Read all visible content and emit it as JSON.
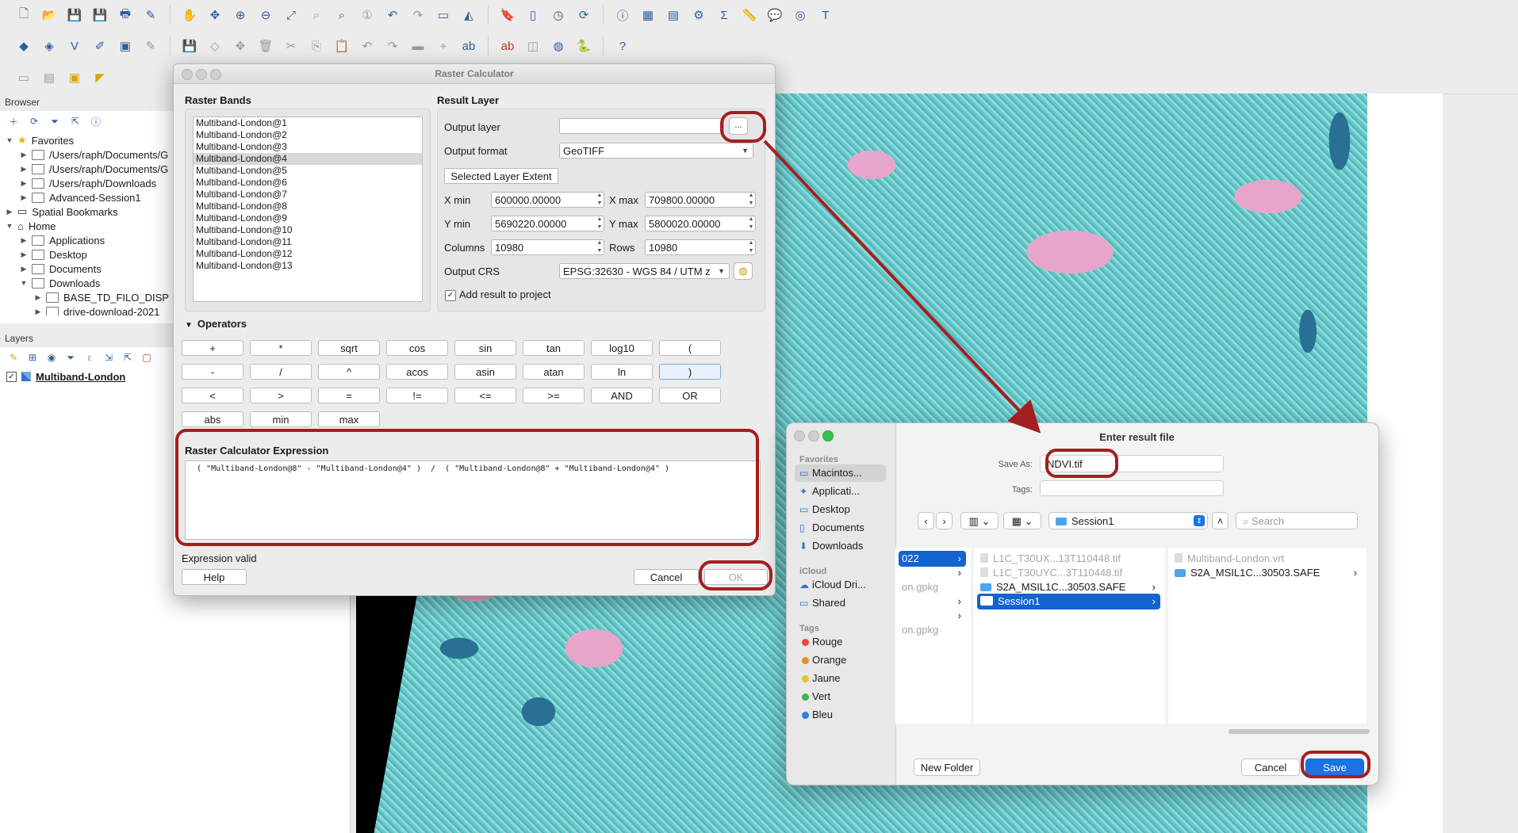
{
  "toolbars": {
    "row1_icons": [
      "new-project-icon",
      "open-project-icon",
      "save-project-icon",
      "save-as-icon",
      "print-layout-icon",
      "style-manager-icon",
      "pan-icon",
      "pan-to-selection-icon",
      "zoom-in-icon",
      "zoom-out-icon",
      "zoom-full-icon",
      "zoom-to-selection-icon",
      "zoom-to-layer-icon",
      "zoom-native-icon",
      "zoom-last-icon",
      "zoom-next-icon",
      "new-map-view-icon",
      "new-3d-view-icon",
      "new-bookmark-icon",
      "show-bookmarks-icon",
      "temporal-icon",
      "refresh-icon",
      "identify-icon",
      "attribute-table-icon",
      "field-calculator-icon",
      "processing-icon",
      "statistics-icon",
      "measure-icon",
      "map-tips-icon",
      "annotation-icon",
      "text-annotation-icon"
    ],
    "row2_icons": [
      "data-source-manager-icon",
      "new-geopackage-icon",
      "new-shapefile-icon",
      "digitize-icon",
      "vertex-tool-icon",
      "edit-pencil-icon",
      "save-edits-icon",
      "add-feature-icon",
      "move-feature-icon",
      "delete-icon",
      "cut-icon",
      "copy-icon",
      "paste-icon",
      "undo-icon",
      "redo-icon",
      "label-icon",
      "label-pin-icon",
      "abc-icon",
      "abc-red-icon",
      "label-tools-icon",
      "plugin-globe-icon",
      "python-icon",
      "help-icon"
    ]
  },
  "browser": {
    "title": "Browser",
    "items": [
      {
        "label": "Favorites",
        "level": 0,
        "open": true
      },
      {
        "label": "/Users/raph/Documents/G",
        "level": 1
      },
      {
        "label": "/Users/raph/Documents/G",
        "level": 1
      },
      {
        "label": "/Users/raph/Downloads",
        "level": 1
      },
      {
        "label": "Advanced-Session1",
        "level": 1
      },
      {
        "label": "Spatial Bookmarks",
        "level": 0
      },
      {
        "label": "Home",
        "level": 0,
        "open": true
      },
      {
        "label": "Applications",
        "level": 1
      },
      {
        "label": "Desktop",
        "level": 1
      },
      {
        "label": "Documents",
        "level": 1
      },
      {
        "label": "Downloads",
        "level": 1,
        "open": true
      },
      {
        "label": "BASE_TD_FILO_DISP",
        "level": 2
      },
      {
        "label": "drive-download-2021",
        "level": 2
      }
    ]
  },
  "layers": {
    "title": "Layers",
    "items": [
      {
        "label": "Multiband-London",
        "checked": true
      }
    ]
  },
  "calc": {
    "title": "Raster Calculator",
    "raster_bands_label": "Raster Bands",
    "bands": [
      "Multiband-London@1",
      "Multiband-London@2",
      "Multiband-London@3",
      "Multiband-London@4",
      "Multiband-London@5",
      "Multiband-London@6",
      "Multiband-London@7",
      "Multiband-London@8",
      "Multiband-London@9",
      "Multiband-London@10",
      "Multiband-London@11",
      "Multiband-London@12",
      "Multiband-London@13"
    ],
    "selected_band_index": 3,
    "result_layer_label": "Result Layer",
    "output_layer_label": "Output layer",
    "output_layer_value": "",
    "browse_label": "...",
    "output_format_label": "Output format",
    "output_format_value": "GeoTIFF",
    "extent_button": "Selected Layer Extent",
    "xmin_label": "X min",
    "xmin_value": "600000.00000",
    "xmax_label": "X max",
    "xmax_value": "709800.00000",
    "ymin_label": "Y min",
    "ymin_value": "5690220.00000",
    "ymax_label": "Y max",
    "ymax_value": "5800020.00000",
    "columns_label": "Columns",
    "columns_value": "10980",
    "rows_label": "Rows",
    "rows_value": "10980",
    "crs_label": "Output CRS",
    "crs_value": "EPSG:32630 - WGS 84 / UTM z",
    "add_result_label": "Add result to project",
    "add_result_checked": true,
    "operators_label": "Operators",
    "operators": [
      [
        "+",
        "*",
        "sqrt",
        "cos",
        "sin",
        "tan",
        "log10",
        "("
      ],
      [
        "-",
        "/",
        "^",
        "acos",
        "asin",
        "atan",
        "ln",
        ")"
      ],
      [
        "<",
        ">",
        "=",
        "!=",
        "<=",
        ">=",
        "AND",
        "OR"
      ],
      [
        "abs",
        "min",
        "max"
      ]
    ],
    "expression_label": "Raster Calculator Expression",
    "expression": " ( \"Multiband-London@8\" - \"Multiband-London@4\" )  /  ( \"Multiband-London@8\" + \"Multiband-London@4\" )",
    "status": "Expression valid",
    "help": "Help",
    "cancel": "Cancel",
    "ok": "OK"
  },
  "save": {
    "title": "Enter result file",
    "save_as_label": "Save As:",
    "save_as_value": "NDVI.tif",
    "tags_label": "Tags:",
    "location": "Session1",
    "search_placeholder": "Search",
    "favorites_head": "Favorites",
    "favorites": [
      "Macintos...",
      "Applicati...",
      "Desktop",
      "Documents",
      "Downloads"
    ],
    "icloud_head": "iCloud",
    "icloud": [
      "iCloud Dri...",
      "Shared"
    ],
    "tags_head": "Tags",
    "tags": [
      {
        "label": "Rouge",
        "color": "#e5483c"
      },
      {
        "label": "Orange",
        "color": "#ef8b24"
      },
      {
        "label": "Jaune",
        "color": "#e8c12a"
      },
      {
        "label": "Vert",
        "color": "#3ab64b"
      },
      {
        "label": "Bleu",
        "color": "#2f7de1"
      }
    ],
    "col0": [
      "022",
      "",
      "on.gpkg",
      "",
      "",
      "on.gpkg"
    ],
    "col1": [
      "L1C_T30UX...13T110448.tif",
      "L1C_T30UYC...3T110448.tif",
      "S2A_MSIL1C...30503.SAFE",
      "Session1"
    ],
    "col2": [
      "Multiband-London.vrt",
      "S2A_MSIL1C...30503.SAFE"
    ],
    "new_folder": "New Folder",
    "cancel": "Cancel",
    "save": "Save"
  },
  "colors": {
    "highlight_ring": "#a41f1f",
    "accent_blue": "#1a73e8"
  }
}
